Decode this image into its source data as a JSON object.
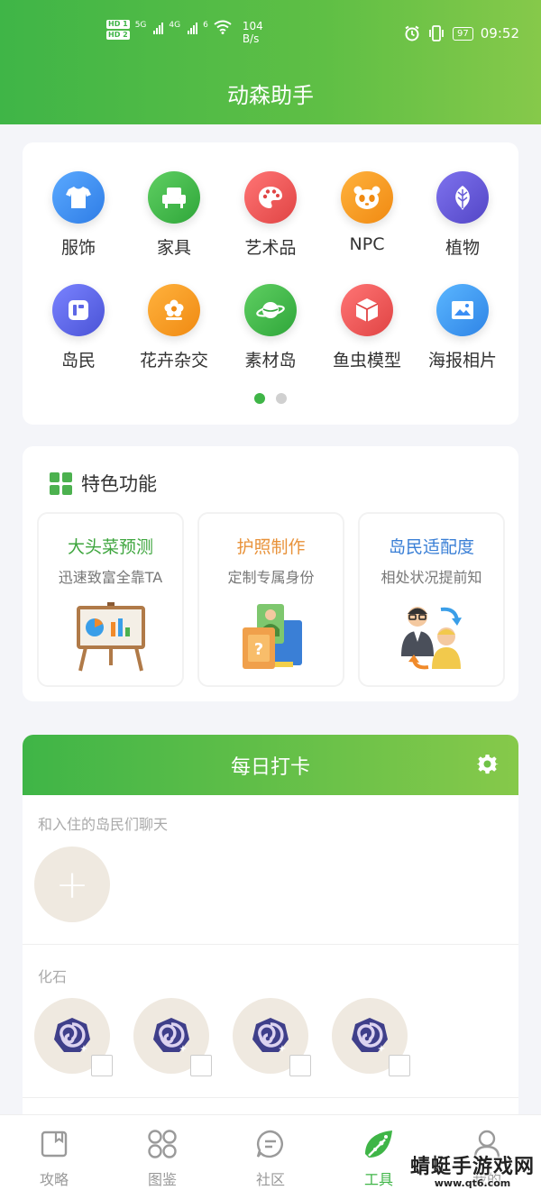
{
  "status_bar": {
    "hd1": "HD 1",
    "hd2": "HD 2",
    "net1": "5G",
    "net2": "4G",
    "net3": "6",
    "speed_value": "104",
    "speed_unit": "B/s",
    "battery": "97",
    "time": "09:52"
  },
  "app": {
    "title": "动森助手"
  },
  "categories": [
    {
      "label": "服饰",
      "icon": "shirt-icon",
      "color": "#3a8ef5"
    },
    {
      "label": "家具",
      "icon": "armchair-icon",
      "color": "#43b84f"
    },
    {
      "label": "艺术品",
      "icon": "palette-icon",
      "color": "#ee5a5a"
    },
    {
      "label": "NPC",
      "icon": "panda-icon",
      "color": "#f59b1e"
    },
    {
      "label": "植物",
      "icon": "leaf-icon",
      "color": "#6a5fd8"
    },
    {
      "label": "岛民",
      "icon": "villager-icon",
      "color": "#5d67e6"
    },
    {
      "label": "花卉杂交",
      "icon": "flower-icon",
      "color": "#f59b1e"
    },
    {
      "label": "素材岛",
      "icon": "planet-icon",
      "color": "#43b84f"
    },
    {
      "label": "鱼虫模型",
      "icon": "cube-icon",
      "color": "#ee5a5a"
    },
    {
      "label": "海报相片",
      "icon": "picture-icon",
      "color": "#3a8ef5"
    }
  ],
  "pager": {
    "pages": 2,
    "current": 1
  },
  "features": {
    "header": "特色功能",
    "items": [
      {
        "title": "大头菜预测",
        "subtitle": "迅速致富全靠TA",
        "color": "#3fa63f",
        "icon": "presentation-board-icon"
      },
      {
        "title": "护照制作",
        "subtitle": "定制专属身份",
        "color": "#e8923a",
        "icon": "passport-icon"
      },
      {
        "title": "岛民适配度",
        "subtitle": "相处状况提前知",
        "color": "#3a7fd6",
        "icon": "people-swap-icon"
      }
    ]
  },
  "daily": {
    "title": "每日打卡",
    "chat_label": "和入住的岛民们聊天",
    "add_symbol": "+",
    "fossil_label": "化石",
    "fossil_count": 4
  },
  "tabs": [
    {
      "label": "攻略",
      "icon": "book-icon",
      "active": false
    },
    {
      "label": "图鉴",
      "icon": "catalog-icon",
      "active": false
    },
    {
      "label": "社区",
      "icon": "chat-icon",
      "active": false
    },
    {
      "label": "工具",
      "icon": "tool-leaf-icon",
      "active": true
    },
    {
      "label": "我的",
      "icon": "user-icon",
      "active": false
    }
  ],
  "watermark": {
    "text": "蜻蜓手游戏网",
    "url": "www.qt6.com"
  }
}
